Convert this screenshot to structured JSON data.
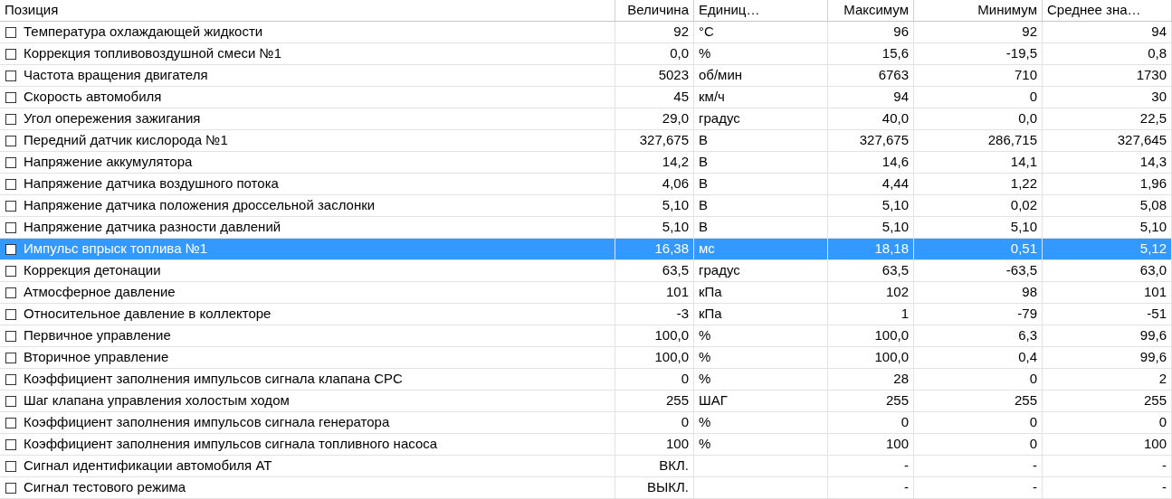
{
  "table": {
    "columns": [
      "Позиция",
      "Величина",
      "Единиц…",
      "Максимум",
      "Минимум",
      "Среднее зна…"
    ],
    "rows": [
      {
        "name": "Температура охлаждающей жидкости",
        "value": "92",
        "unit": "°C",
        "max": "96",
        "min": "92",
        "avg": "94",
        "checked": false,
        "selected": false
      },
      {
        "name": "Коррекция топливовоздушной смеси №1",
        "value": "0,0",
        "unit": "%",
        "max": "15,6",
        "min": "-19,5",
        "avg": "0,8",
        "checked": false,
        "selected": false
      },
      {
        "name": "Частота вращения двигателя",
        "value": "5023",
        "unit": "об/мин",
        "max": "6763",
        "min": "710",
        "avg": "1730",
        "checked": false,
        "selected": false
      },
      {
        "name": "Скорость автомобиля",
        "value": "45",
        "unit": "км/ч",
        "max": "94",
        "min": "0",
        "avg": "30",
        "checked": false,
        "selected": false
      },
      {
        "name": "Угол опережения зажигания",
        "value": "29,0",
        "unit": "градус",
        "max": "40,0",
        "min": "0,0",
        "avg": "22,5",
        "checked": false,
        "selected": false
      },
      {
        "name": "Передний датчик кислорода №1",
        "value": "327,675",
        "unit": "В",
        "max": "327,675",
        "min": "286,715",
        "avg": "327,645",
        "checked": false,
        "selected": false
      },
      {
        "name": "Напряжение аккумулятора",
        "value": "14,2",
        "unit": "В",
        "max": "14,6",
        "min": "14,1",
        "avg": "14,3",
        "checked": false,
        "selected": false
      },
      {
        "name": "Напряжение датчика воздушного потока",
        "value": "4,06",
        "unit": "В",
        "max": "4,44",
        "min": "1,22",
        "avg": "1,96",
        "checked": false,
        "selected": false
      },
      {
        "name": "Напряжение датчика положения дроссельной заслонки",
        "value": "5,10",
        "unit": "В",
        "max": "5,10",
        "min": "0,02",
        "avg": "5,08",
        "checked": false,
        "selected": false
      },
      {
        "name": "Напряжение датчика разности давлений",
        "value": "5,10",
        "unit": "В",
        "max": "5,10",
        "min": "5,10",
        "avg": "5,10",
        "checked": false,
        "selected": false
      },
      {
        "name": "Импульс впрыск топлива №1",
        "value": "16,38",
        "unit": "мс",
        "max": "18,18",
        "min": "0,51",
        "avg": "5,12",
        "checked": false,
        "selected": true
      },
      {
        "name": "Коррекция детонации",
        "value": "63,5",
        "unit": "градус",
        "max": "63,5",
        "min": "-63,5",
        "avg": "63,0",
        "checked": false,
        "selected": false
      },
      {
        "name": "Атмосферное давление",
        "value": "101",
        "unit": "кПа",
        "max": "102",
        "min": "98",
        "avg": "101",
        "checked": false,
        "selected": false
      },
      {
        "name": "Относительное давление в коллекторе",
        "value": "-3",
        "unit": "кПа",
        "max": "1",
        "min": "-79",
        "avg": "-51",
        "checked": false,
        "selected": false
      },
      {
        "name": "Первичное управление",
        "value": "100,0",
        "unit": "%",
        "max": "100,0",
        "min": "6,3",
        "avg": "99,6",
        "checked": false,
        "selected": false
      },
      {
        "name": "Вторичное управление",
        "value": "100,0",
        "unit": "%",
        "max": "100,0",
        "min": "0,4",
        "avg": "99,6",
        "checked": false,
        "selected": false
      },
      {
        "name": "Коэффициент заполнения импульсов сигнала клапана CPC",
        "value": "0",
        "unit": "%",
        "max": "28",
        "min": "0",
        "avg": "2",
        "checked": false,
        "selected": false
      },
      {
        "name": "Шаг клапана управления холостым ходом",
        "value": "255",
        "unit": "ШАГ",
        "max": "255",
        "min": "255",
        "avg": "255",
        "checked": false,
        "selected": false
      },
      {
        "name": "Коэффициент заполнения импульсов сигнала генератора",
        "value": "0",
        "unit": "%",
        "max": "0",
        "min": "0",
        "avg": "0",
        "checked": false,
        "selected": false
      },
      {
        "name": "Коэффициент заполнения импульсов сигнала топливного насоса",
        "value": "100",
        "unit": "%",
        "max": "100",
        "min": "0",
        "avg": "100",
        "checked": false,
        "selected": false
      },
      {
        "name": "Сигнал идентификации автомобиля AT",
        "value": "ВКЛ.",
        "unit": "",
        "max": "-",
        "min": "-",
        "avg": "-",
        "checked": false,
        "selected": false
      },
      {
        "name": "Сигнал тестового режима",
        "value": "ВЫКЛ.",
        "unit": "",
        "max": "-",
        "min": "-",
        "avg": "-",
        "checked": false,
        "selected": false
      }
    ]
  }
}
